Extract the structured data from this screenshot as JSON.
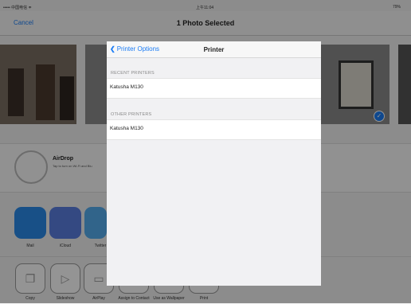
{
  "status_bar": {
    "carrier": "••••• 中国电信 ≑",
    "time": "上午11:04",
    "battery": "79%"
  },
  "nav": {
    "cancel": "Cancel",
    "title": "1 Photo Selected"
  },
  "airdrop": {
    "title": "AirDrop",
    "subtitle": "Tap to turn on Wi-Fi and Blu"
  },
  "apps": [
    {
      "label": "Mail",
      "color": "#2a8be8",
      "icon": "mail-icon"
    },
    {
      "label": "iCloud",
      "color": "#5a7fe0",
      "icon": "cloud-icon"
    },
    {
      "label": "Twitter",
      "color": "#55acee",
      "icon": "twitter-icon"
    }
  ],
  "actions": [
    {
      "label": "Copy",
      "icon": "copy-icon"
    },
    {
      "label": "Slideshow",
      "icon": "play-icon"
    },
    {
      "label": "AirPlay",
      "icon": "airplay-icon"
    },
    {
      "label": "Assign to Contact",
      "icon": "contact-icon"
    },
    {
      "label": "Use as Wallpaper",
      "icon": "wallpaper-icon"
    },
    {
      "label": "Print",
      "icon": "print-icon"
    }
  ],
  "popover": {
    "back_label": "Printer Options",
    "title": "Printer",
    "recent_label": "RECENT PRINTERS",
    "recent_printers": [
      "Katusha M130"
    ],
    "other_label": "OTHER PRINTERS",
    "other_printers": [
      "Katusha M130"
    ]
  },
  "colors": {
    "accent": "#1a7cf5"
  }
}
